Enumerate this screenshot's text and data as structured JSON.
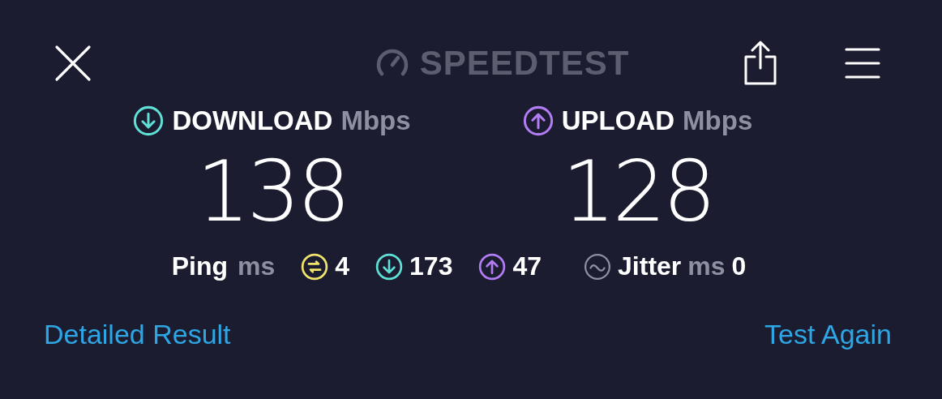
{
  "header": {
    "logo": "SPEEDTEST"
  },
  "results": [
    {
      "kind": "download",
      "label": "DOWNLOAD",
      "unit": "Mbps",
      "value": "138"
    },
    {
      "kind": "upload",
      "label": "UPLOAD",
      "unit": "Mbps",
      "value": "128"
    }
  ],
  "ping": {
    "label": "Ping",
    "unit": "ms",
    "items": [
      {
        "kind": "idle",
        "value": "4"
      },
      {
        "kind": "download",
        "value": "173"
      },
      {
        "kind": "upload",
        "value": "47"
      }
    ]
  },
  "jitter": {
    "label": "Jitter",
    "unit": "ms",
    "value": "0"
  },
  "links": [
    "Detailed Result",
    "Test Again"
  ]
}
